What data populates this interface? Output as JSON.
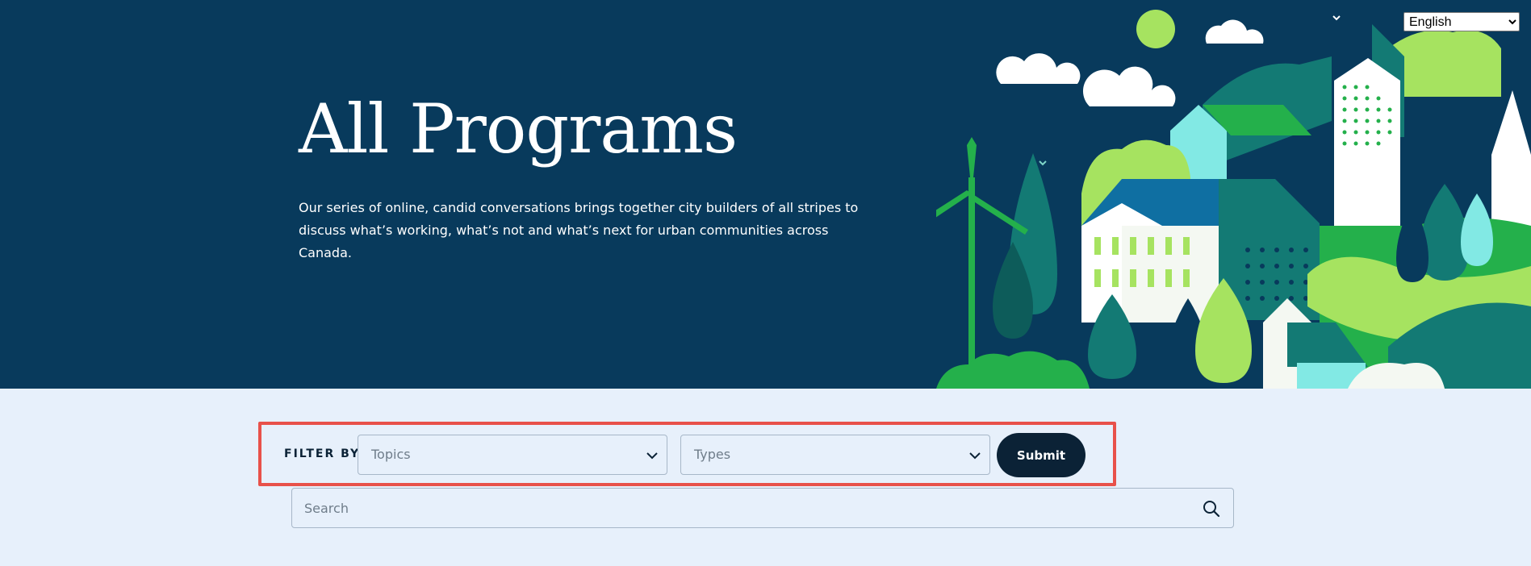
{
  "hero": {
    "title": "All Programs",
    "description": "Our series of online, candid conversations brings together city builders of all stripes to discuss what’s working, what’s not and what’s next for urban communities across Canada."
  },
  "language": {
    "selected": "English",
    "options": [
      "English"
    ]
  },
  "filters": {
    "label": "FILTER BY",
    "topics_placeholder": "Topics",
    "types_placeholder": "Types",
    "submit_label": "Submit"
  },
  "search": {
    "placeholder": "Search"
  },
  "icons": [
    "chevron-down-icon",
    "search-icon",
    "city-illustration"
  ],
  "colors": {
    "hero_bg": "#083a5c",
    "page_bg": "#e7f0fb",
    "button_bg": "#0b2236",
    "highlight": "#e8514a"
  }
}
